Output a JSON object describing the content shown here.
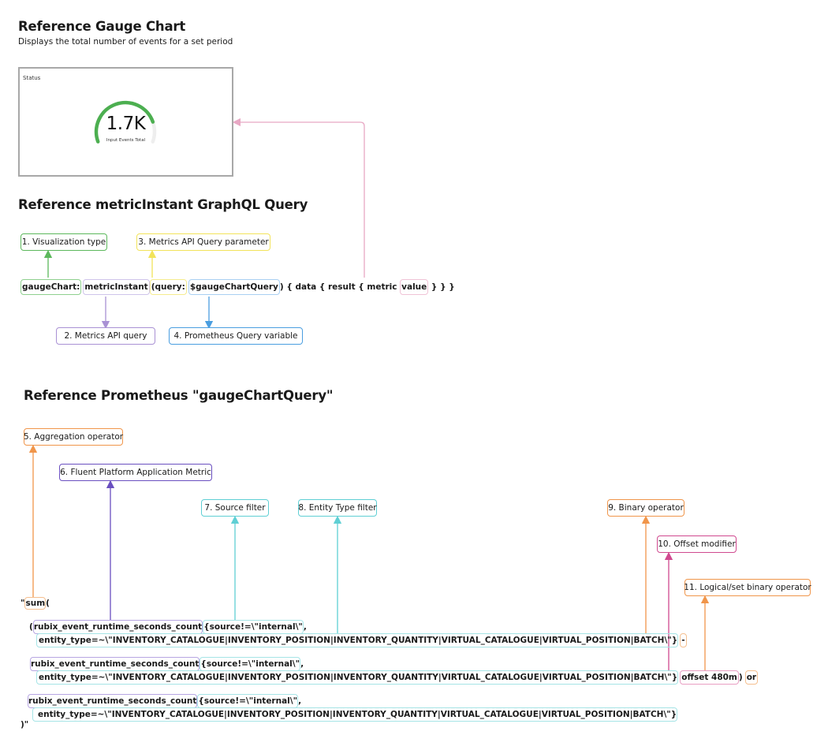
{
  "gauge_section": {
    "title": "Reference Gauge Chart",
    "subtitle": "Displays the total number of events for a set period",
    "card": {
      "title": "Status",
      "value": "1.7K",
      "label": "Input Events Total",
      "fill_fraction": 0.82,
      "fill_color": "#4caf50",
      "track_color": "#eeeeee"
    }
  },
  "graphql_section": {
    "title": "Reference metricInstant GraphQL Query",
    "query_parts": {
      "viz": "gaugeChart:",
      "api": "metricInstant",
      "param": "(query:",
      "var": "$gaugeChartQuery",
      "mid": ") { data { result { metric ",
      "value": "value",
      "tail": " } } }"
    },
    "labels": [
      {
        "id": "1",
        "text": "1. Visualization type",
        "color": "#5cb85c"
      },
      {
        "id": "2",
        "text": "2. Metrics API query",
        "color": "#a991d4"
      },
      {
        "id": "3",
        "text": "3. Metrics API Query parameter",
        "color": "#f2e35a"
      },
      {
        "id": "4",
        "text": "4. Prometheus Query variable",
        "color": "#4a9ee0"
      }
    ],
    "value_link_color": "#e8a8c4"
  },
  "prom_section": {
    "title": "Reference Prometheus \"gaugeChartQuery\"",
    "labels": [
      {
        "id": "5",
        "text": "5. Aggregation operator",
        "color": "#f0954a"
      },
      {
        "id": "6",
        "text": "6. Fluent Platform Application Metric",
        "color": "#6a4fc0"
      },
      {
        "id": "7",
        "text": "7. Source filter",
        "color": "#5fcfd4"
      },
      {
        "id": "8",
        "text": "8. Entity Type filter",
        "color": "#5fcfd4"
      },
      {
        "id": "9",
        "text": "9. Binary operator",
        "color": "#f0954a"
      },
      {
        "id": "10",
        "text": "10. Offset modifier",
        "color": "#d0498f"
      },
      {
        "id": "11",
        "text": "11. Logical/set binary operator",
        "color": "#f0954a"
      }
    ],
    "code": {
      "open_quote": "\"",
      "sum": "sum",
      "open_paren": "(",
      "paren": "(",
      "metric": "rubix_event_runtime_seconds_count",
      "source_filter": "{source!=\\\"internal\\\"",
      "comma": ",",
      "entity_filter": "entity_type=~\\\"INVENTORY_CATALOGUE|INVENTORY_POSITION|INVENTORY_QUANTITY|VIRTUAL_CATALOGUE|VIRTUAL_POSITION|BATCH\\\"}",
      "minus": "-",
      "offset": "offset 480m",
      "close_paren": ")",
      "or": "or",
      "close": ")\""
    }
  }
}
